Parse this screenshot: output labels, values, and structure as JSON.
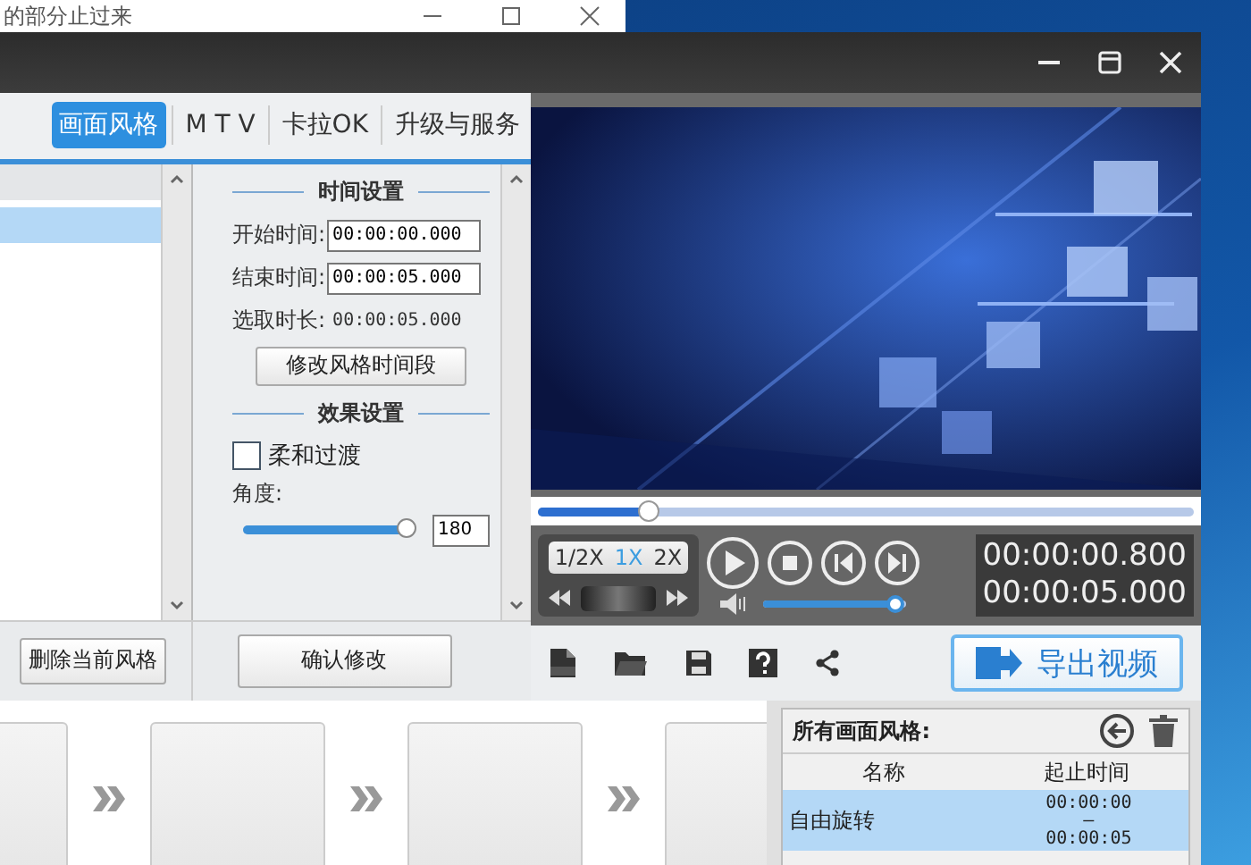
{
  "background_window": {
    "title": "的部分止过来"
  },
  "tabs": [
    {
      "label": "画面风格",
      "selected": true
    },
    {
      "label": "M T V",
      "selected": false
    },
    {
      "label": "卡拉OK",
      "selected": false
    },
    {
      "label": "升级与服务",
      "selected": false
    }
  ],
  "style_list": {
    "rows": [
      {
        "selected": false
      },
      {
        "selected": true
      }
    ]
  },
  "time_settings": {
    "heading": "时间设置",
    "start_label": "开始时间:",
    "start_value": "00:00:00.000",
    "end_label": "结束时间:",
    "end_value": "00:00:05.000",
    "duration_label": "选取时长:",
    "duration_value": "00:00:05.000",
    "button": "修改风格时间段"
  },
  "effect_settings": {
    "heading": "效果设置",
    "soft_transition": {
      "label": "柔和过渡",
      "checked": false
    },
    "angle": {
      "label": "角度:",
      "level": 1.0,
      "value": "180"
    }
  },
  "delete_button": "删除当前风格",
  "confirm_button": "确认修改",
  "progress": {
    "level": 0.17
  },
  "speeds": [
    {
      "label": "1/2X",
      "selected": false
    },
    {
      "label": "1X",
      "selected": true
    },
    {
      "label": "2X",
      "selected": false
    }
  ],
  "volume": {
    "level": 0.93
  },
  "current_time": "00:00:00.800",
  "total_time": "00:00:05.000",
  "export_button": "导出视频",
  "style_panel": {
    "title": "所有画面风格:",
    "columns": [
      "名称",
      "起止时间"
    ],
    "rows": [
      {
        "name": "自由旋转",
        "start": "00:00:00",
        "separator": "—",
        "end": "00:00:05",
        "selected": true
      }
    ]
  }
}
